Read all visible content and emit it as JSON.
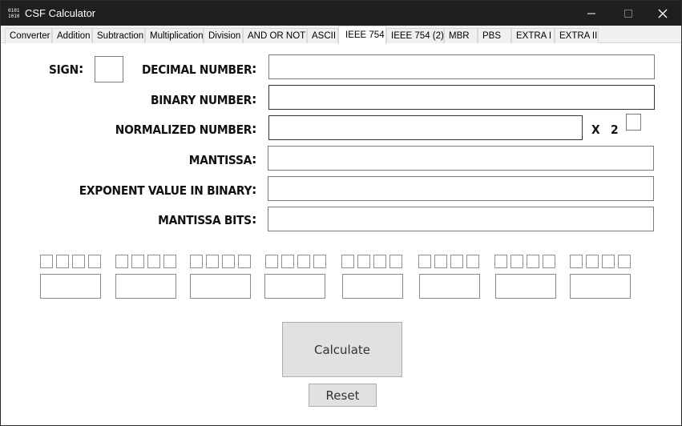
{
  "window": {
    "title": "CSF Calculator"
  },
  "controls": {
    "minimize": "—",
    "maximize": "☐",
    "close": "✕"
  },
  "tabs": [
    {
      "label": "Converter",
      "active": false
    },
    {
      "label": "Addition",
      "active": false
    },
    {
      "label": "Subtraction",
      "active": false
    },
    {
      "label": "Multiplication",
      "active": false
    },
    {
      "label": "Division",
      "active": false
    },
    {
      "label": "AND OR NOT",
      "active": false
    },
    {
      "label": "ASCII",
      "active": false
    },
    {
      "label": "IEEE 754",
      "active": true
    },
    {
      "label": "IEEE 754 (2)",
      "active": false
    },
    {
      "label": "MBR",
      "active": false
    },
    {
      "label": "PBS",
      "active": false
    },
    {
      "label": "EXTRA I",
      "active": false
    },
    {
      "label": "EXTRA II",
      "active": false
    }
  ],
  "form": {
    "sign_label": "SIGN",
    "decimal_label": "DECIMAL NUMBER",
    "binary_label": "BINARY NUMBER",
    "normalized_label": "NORMALIZED NUMBER",
    "mantissa_label": "MANTISSA",
    "exponent_label": "EXPONENT VALUE IN BINARY",
    "mantissa_bits_label": "MANTISSA BITS",
    "times_label": "X",
    "base_label": "2",
    "colon": ":",
    "sign_value": "",
    "decimal_value": "",
    "binary_value": "",
    "normalized_value": "",
    "exponent_power": "",
    "mantissa_value": "",
    "exponent_value": "",
    "mantissa_bits_value": ""
  },
  "buttons": {
    "calculate": "Calculate",
    "reset": "Reset"
  }
}
